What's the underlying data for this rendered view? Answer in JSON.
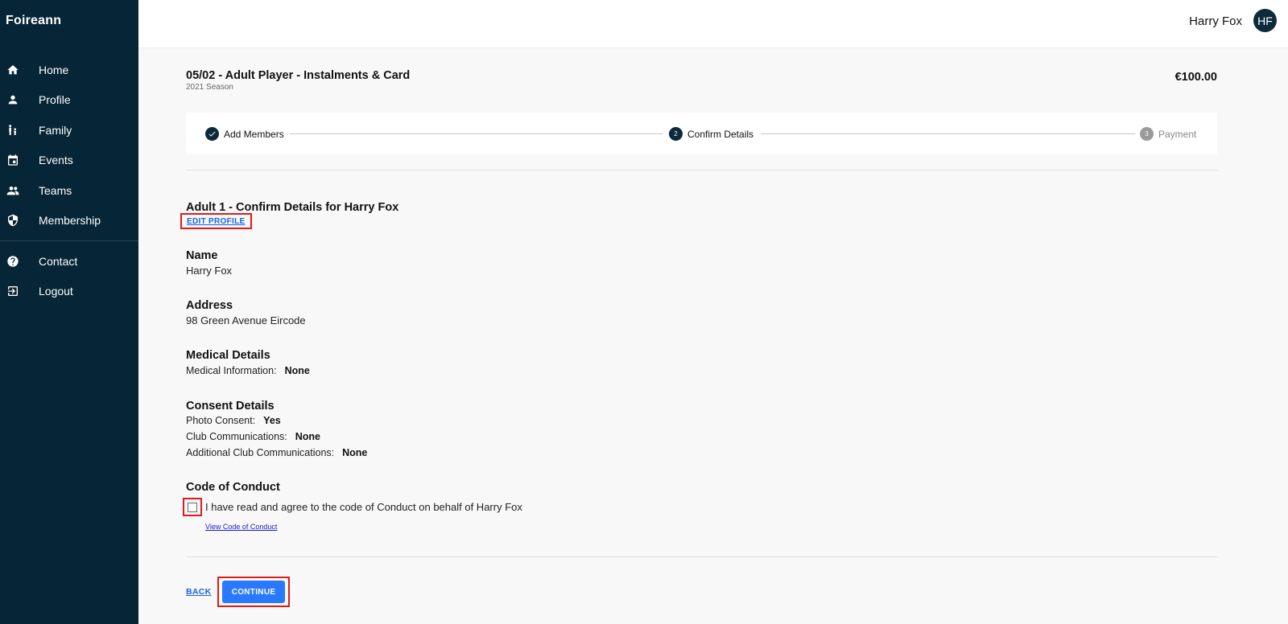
{
  "brand": "Foireann",
  "sidebar": {
    "items": [
      {
        "label": "Home",
        "icon": "home-icon"
      },
      {
        "label": "Profile",
        "icon": "person-icon"
      },
      {
        "label": "Family",
        "icon": "family-icon"
      },
      {
        "label": "Events",
        "icon": "calendar-icon"
      },
      {
        "label": "Teams",
        "icon": "group-icon"
      },
      {
        "label": "Membership",
        "icon": "shield-icon"
      }
    ],
    "secondary": [
      {
        "label": "Contact",
        "icon": "help-icon"
      },
      {
        "label": "Logout",
        "icon": "logout-icon"
      }
    ]
  },
  "header": {
    "user_name": "Harry Fox",
    "avatar_initials": "HF"
  },
  "product": {
    "title": "05/02 - Adult Player - Instalments & Card",
    "season": "2021 Season",
    "price": "€100.00"
  },
  "stepper": {
    "steps": [
      {
        "label": "Add Members",
        "status": "complete"
      },
      {
        "number": "2",
        "label": "Confirm Details",
        "status": "active"
      },
      {
        "number": "3",
        "label": "Payment",
        "status": "pending"
      }
    ]
  },
  "confirm": {
    "heading": "Adult 1 - Confirm Details for Harry Fox",
    "edit_profile": "EDIT PROFILE",
    "name_title": "Name",
    "name_value": "Harry Fox",
    "address_title": "Address",
    "address_value": "98 Green Avenue Eircode",
    "medical_title": "Medical Details",
    "medical_label": "Medical Information:",
    "medical_value": "None",
    "consent_title": "Consent Details",
    "photo_label": "Photo Consent:",
    "photo_value": "Yes",
    "club_label": "Club Communications:",
    "club_value": "None",
    "additional_label": "Additional Club Communications:",
    "additional_value": "None",
    "conduct_title": "Code of Conduct",
    "conduct_checkbox_label": "I have read and agree to the code of Conduct on behalf of Harry Fox",
    "conduct_checked": false,
    "conduct_link": "View Code of Conduct"
  },
  "actions": {
    "back": "BACK",
    "continue": "CONTINUE"
  },
  "colors": {
    "sidebar_bg": "#062536",
    "primary_button": "#2979ff",
    "link": "#1a63e0",
    "highlight": "#e01a1a"
  }
}
